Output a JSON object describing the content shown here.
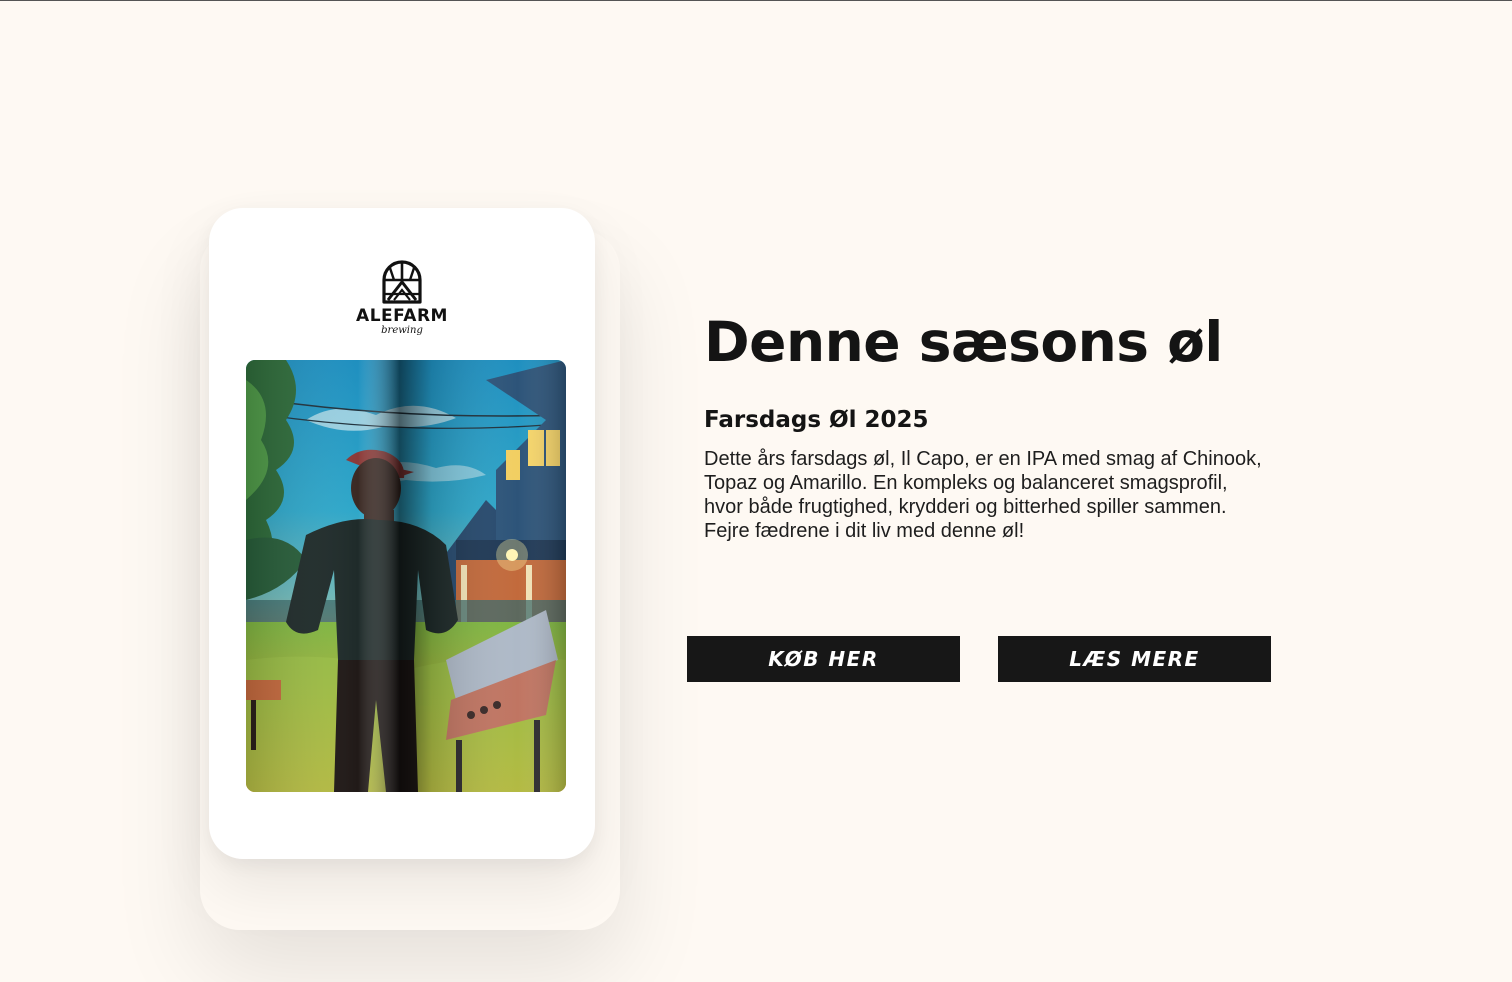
{
  "brand": {
    "name": "ALEFARM",
    "tagline": "brewing",
    "logo_icon": "alefarm-crest-icon"
  },
  "hero": {
    "title": "Denne sæsons øl",
    "beer_name": "Farsdags Øl 2025",
    "description": "Dette års farsdags øl, Il Capo, er en IPA med smag af Chinook, Topaz og Amarillo. En kompleks og balanceret smagsprofil, hvor både frugtighed, krydderi og bitterhed spiller sammen. Fejre fædrene i dit liv med denne øl!"
  },
  "actions": {
    "buy_label": "KØB HER",
    "read_more_label": "LÆS MERE"
  },
  "colors": {
    "background": "#fef9f3",
    "card": "#ffffff",
    "button": "#171717",
    "button_text": "#ffffff",
    "text": "#141414"
  }
}
